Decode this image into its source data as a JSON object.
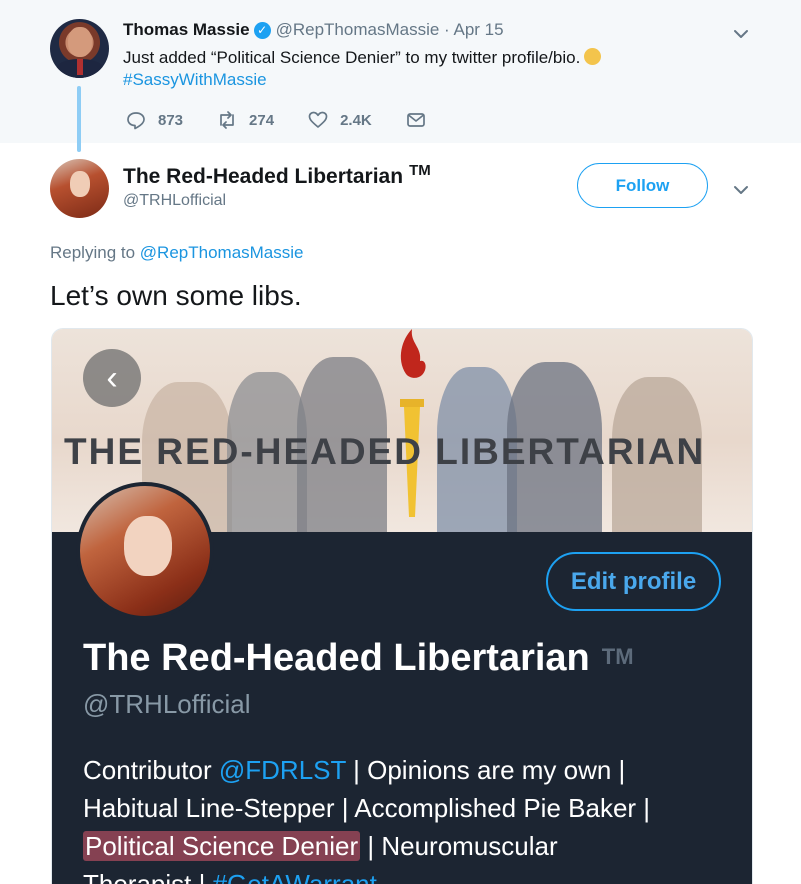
{
  "parent_tweet": {
    "name": "Thomas Massie",
    "handle_date": "@RepThomasMassie · Apr 15",
    "text": "Just added “Political Science Denier” to my twitter profile/bio.",
    "hashtag": "#SassyWithMassie",
    "reply_count": "873",
    "retweet_count": "274",
    "like_count": "2.4K"
  },
  "reply_tweet": {
    "name": "The Red-Headed Libertarian",
    "tm": "TM",
    "handle": "@TRHLofficial",
    "follow_label": "Follow",
    "replying_prefix": "Replying to",
    "replying_to": "@RepThomasMassie",
    "text": "Let’s own some libs."
  },
  "embedded_image": {
    "banner_title": "THE RED-HEADED LIBERTARIAN",
    "edit_profile_label": "Edit profile",
    "profile_name": "The Red-Headed Libertarian",
    "profile_tm": "TM",
    "profile_handle": "@TRHLofficial",
    "bio": {
      "contributor": "Contributor",
      "fdrlst": "@FDRLST",
      "opinions": "| Opinions are my own |",
      "line2": "Habitual Line-Stepper | Accomplished Pie Baker |",
      "highlight": "Political Science Denier",
      "line3_rest": "| Neuromuscular",
      "line4_start": "Therapist |",
      "hashtag": "#GetAWarrant"
    }
  },
  "colors": {
    "accent": "#1da1f2",
    "link": "#1b95e0",
    "muted": "#657786",
    "profile_bg": "#1c2532"
  }
}
